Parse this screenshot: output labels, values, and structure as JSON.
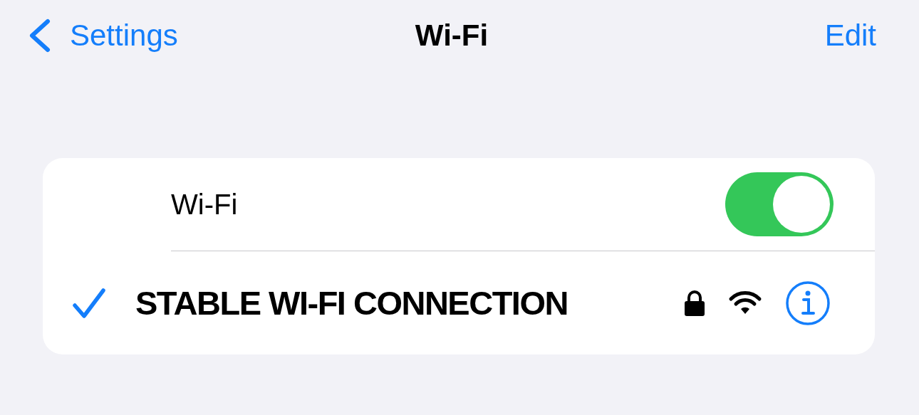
{
  "nav": {
    "back_label": "Settings",
    "title": "Wi-Fi",
    "action": "Edit"
  },
  "wifi": {
    "label": "Wi-Fi",
    "on": true
  },
  "networks": [
    {
      "name": "STABLE WI-FI CONNECTION",
      "selected": true,
      "locked": true
    }
  ]
}
